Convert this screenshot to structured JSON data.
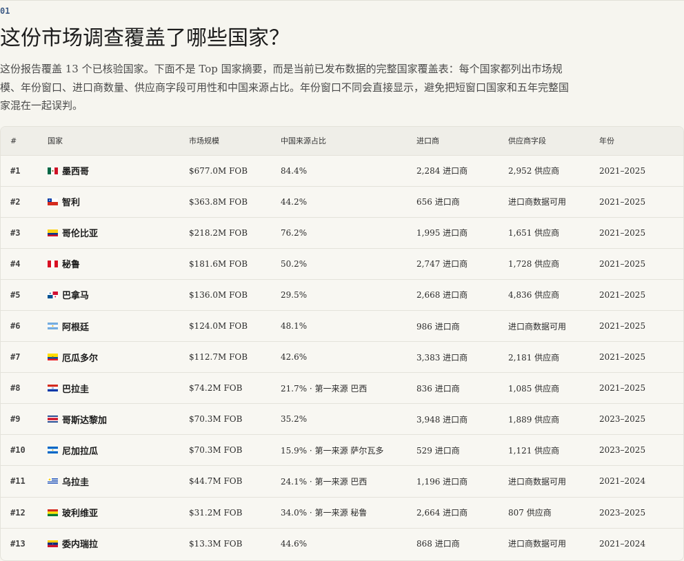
{
  "section": {
    "number": "01"
  },
  "page": {
    "title": "这份市场调查覆盖了哪些国家？",
    "intro": "这份报告覆盖 13 个已核验国家。下面不是 Top 国家摘要，而是当前已发布数据的完整国家覆盖表：每个国家都列出市场规模、年份窗口、进口商数量、供应商字段可用性和中国来源占比。年份窗口不同会直接显示，避免把短窗口国家和五年完整国家混在一起误判。"
  },
  "table": {
    "headers": {
      "rank": "#",
      "country": "国家",
      "market_size": "市场规模",
      "china_share": "中国来源占比",
      "importers": "进口商",
      "suppliers": "供应商字段",
      "years": "年份"
    },
    "rows": [
      {
        "rank": "#1",
        "flag_icon": "mexico-flag-icon",
        "flag": "mx",
        "country": "墨西哥",
        "market_size": "$677.0M FOB",
        "china_share": "84.4%",
        "importers": "2,284 进口商",
        "suppliers": "2,952 供应商",
        "years": "2021–2025"
      },
      {
        "rank": "#2",
        "flag_icon": "chile-flag-icon",
        "flag": "cl",
        "country": "智利",
        "market_size": "$363.8M FOB",
        "china_share": "44.2%",
        "importers": "656 进口商",
        "suppliers": "进口商数据可用",
        "years": "2021–2025"
      },
      {
        "rank": "#3",
        "flag_icon": "colombia-flag-icon",
        "flag": "co",
        "country": "哥伦比亚",
        "market_size": "$218.2M FOB",
        "china_share": "76.2%",
        "importers": "1,995 进口商",
        "suppliers": "1,651 供应商",
        "years": "2021–2025"
      },
      {
        "rank": "#4",
        "flag_icon": "peru-flag-icon",
        "flag": "pe",
        "country": "秘鲁",
        "market_size": "$181.6M FOB",
        "china_share": "50.2%",
        "importers": "2,747 进口商",
        "suppliers": "1,728 供应商",
        "years": "2021–2025"
      },
      {
        "rank": "#5",
        "flag_icon": "panama-flag-icon",
        "flag": "pa",
        "country": "巴拿马",
        "market_size": "$136.0M FOB",
        "china_share": "29.5%",
        "importers": "2,668 进口商",
        "suppliers": "4,836 供应商",
        "years": "2021–2025"
      },
      {
        "rank": "#6",
        "flag_icon": "argentina-flag-icon",
        "flag": "ar",
        "country": "阿根廷",
        "market_size": "$124.0M FOB",
        "china_share": "48.1%",
        "importers": "986 进口商",
        "suppliers": "进口商数据可用",
        "years": "2021–2025"
      },
      {
        "rank": "#7",
        "flag_icon": "ecuador-flag-icon",
        "flag": "ec",
        "country": "厄瓜多尔",
        "market_size": "$112.7M FOB",
        "china_share": "42.6%",
        "importers": "3,383 进口商",
        "suppliers": "2,181 供应商",
        "years": "2021–2025"
      },
      {
        "rank": "#8",
        "flag_icon": "paraguay-flag-icon",
        "flag": "py",
        "country": "巴拉圭",
        "market_size": "$74.2M FOB",
        "china_share": "21.7% · 第一来源 巴西",
        "importers": "836 进口商",
        "suppliers": "1,085 供应商",
        "years": "2021–2025"
      },
      {
        "rank": "#9",
        "flag_icon": "costa-rica-flag-icon",
        "flag": "cr",
        "country": "哥斯达黎加",
        "market_size": "$70.3M FOB",
        "china_share": "35.2%",
        "importers": "3,948 进口商",
        "suppliers": "1,889 供应商",
        "years": "2023–2025"
      },
      {
        "rank": "#10",
        "flag_icon": "nicaragua-flag-icon",
        "flag": "ni",
        "country": "尼加拉瓜",
        "market_size": "$70.3M FOB",
        "china_share": "15.9% · 第一来源 萨尔瓦多",
        "importers": "529 进口商",
        "suppliers": "1,121 供应商",
        "years": "2023–2025"
      },
      {
        "rank": "#11",
        "flag_icon": "uruguay-flag-icon",
        "flag": "uy",
        "country": "乌拉圭",
        "market_size": "$44.7M FOB",
        "china_share": "24.1% · 第一来源 巴西",
        "importers": "1,196 进口商",
        "suppliers": "进口商数据可用",
        "years": "2021–2024"
      },
      {
        "rank": "#12",
        "flag_icon": "bolivia-flag-icon",
        "flag": "bo",
        "country": "玻利维亚",
        "market_size": "$31.2M FOB",
        "china_share": "34.0% · 第一来源 秘鲁",
        "importers": "2,664 进口商",
        "suppliers": "807 供应商",
        "years": "2023–2025"
      },
      {
        "rank": "#13",
        "flag_icon": "venezuela-flag-icon",
        "flag": "ve",
        "country": "委内瑞拉",
        "market_size": "$13.3M FOB",
        "china_share": "44.6%",
        "importers": "868 进口商",
        "suppliers": "进口商数据可用",
        "years": "2021–2024"
      }
    ]
  }
}
